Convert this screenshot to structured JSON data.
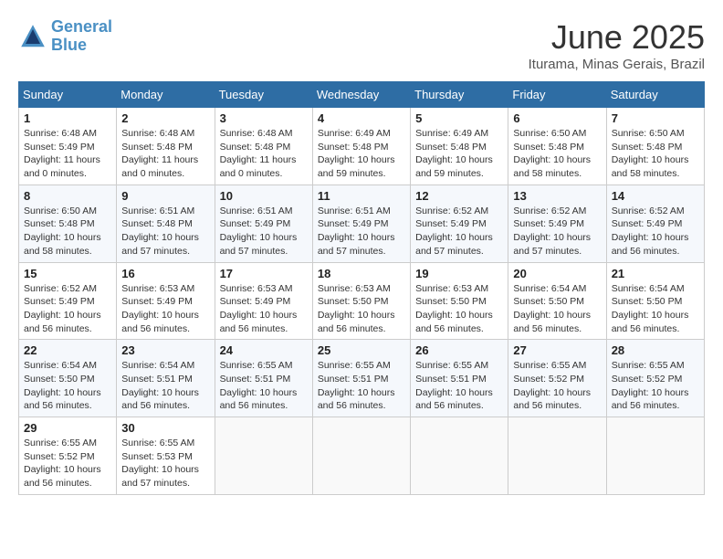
{
  "header": {
    "logo_line1": "General",
    "logo_line2": "Blue",
    "title": "June 2025",
    "subtitle": "Iturama, Minas Gerais, Brazil"
  },
  "columns": [
    "Sunday",
    "Monday",
    "Tuesday",
    "Wednesday",
    "Thursday",
    "Friday",
    "Saturday"
  ],
  "weeks": [
    [
      {
        "num": "1",
        "detail": "Sunrise: 6:48 AM\nSunset: 5:49 PM\nDaylight: 11 hours\nand 0 minutes."
      },
      {
        "num": "2",
        "detail": "Sunrise: 6:48 AM\nSunset: 5:48 PM\nDaylight: 11 hours\nand 0 minutes."
      },
      {
        "num": "3",
        "detail": "Sunrise: 6:48 AM\nSunset: 5:48 PM\nDaylight: 11 hours\nand 0 minutes."
      },
      {
        "num": "4",
        "detail": "Sunrise: 6:49 AM\nSunset: 5:48 PM\nDaylight: 10 hours\nand 59 minutes."
      },
      {
        "num": "5",
        "detail": "Sunrise: 6:49 AM\nSunset: 5:48 PM\nDaylight: 10 hours\nand 59 minutes."
      },
      {
        "num": "6",
        "detail": "Sunrise: 6:50 AM\nSunset: 5:48 PM\nDaylight: 10 hours\nand 58 minutes."
      },
      {
        "num": "7",
        "detail": "Sunrise: 6:50 AM\nSunset: 5:48 PM\nDaylight: 10 hours\nand 58 minutes."
      }
    ],
    [
      {
        "num": "8",
        "detail": "Sunrise: 6:50 AM\nSunset: 5:48 PM\nDaylight: 10 hours\nand 58 minutes."
      },
      {
        "num": "9",
        "detail": "Sunrise: 6:51 AM\nSunset: 5:48 PM\nDaylight: 10 hours\nand 57 minutes."
      },
      {
        "num": "10",
        "detail": "Sunrise: 6:51 AM\nSunset: 5:49 PM\nDaylight: 10 hours\nand 57 minutes."
      },
      {
        "num": "11",
        "detail": "Sunrise: 6:51 AM\nSunset: 5:49 PM\nDaylight: 10 hours\nand 57 minutes."
      },
      {
        "num": "12",
        "detail": "Sunrise: 6:52 AM\nSunset: 5:49 PM\nDaylight: 10 hours\nand 57 minutes."
      },
      {
        "num": "13",
        "detail": "Sunrise: 6:52 AM\nSunset: 5:49 PM\nDaylight: 10 hours\nand 57 minutes."
      },
      {
        "num": "14",
        "detail": "Sunrise: 6:52 AM\nSunset: 5:49 PM\nDaylight: 10 hours\nand 56 minutes."
      }
    ],
    [
      {
        "num": "15",
        "detail": "Sunrise: 6:52 AM\nSunset: 5:49 PM\nDaylight: 10 hours\nand 56 minutes."
      },
      {
        "num": "16",
        "detail": "Sunrise: 6:53 AM\nSunset: 5:49 PM\nDaylight: 10 hours\nand 56 minutes."
      },
      {
        "num": "17",
        "detail": "Sunrise: 6:53 AM\nSunset: 5:49 PM\nDaylight: 10 hours\nand 56 minutes."
      },
      {
        "num": "18",
        "detail": "Sunrise: 6:53 AM\nSunset: 5:50 PM\nDaylight: 10 hours\nand 56 minutes."
      },
      {
        "num": "19",
        "detail": "Sunrise: 6:53 AM\nSunset: 5:50 PM\nDaylight: 10 hours\nand 56 minutes."
      },
      {
        "num": "20",
        "detail": "Sunrise: 6:54 AM\nSunset: 5:50 PM\nDaylight: 10 hours\nand 56 minutes."
      },
      {
        "num": "21",
        "detail": "Sunrise: 6:54 AM\nSunset: 5:50 PM\nDaylight: 10 hours\nand 56 minutes."
      }
    ],
    [
      {
        "num": "22",
        "detail": "Sunrise: 6:54 AM\nSunset: 5:50 PM\nDaylight: 10 hours\nand 56 minutes."
      },
      {
        "num": "23",
        "detail": "Sunrise: 6:54 AM\nSunset: 5:51 PM\nDaylight: 10 hours\nand 56 minutes."
      },
      {
        "num": "24",
        "detail": "Sunrise: 6:55 AM\nSunset: 5:51 PM\nDaylight: 10 hours\nand 56 minutes."
      },
      {
        "num": "25",
        "detail": "Sunrise: 6:55 AM\nSunset: 5:51 PM\nDaylight: 10 hours\nand 56 minutes."
      },
      {
        "num": "26",
        "detail": "Sunrise: 6:55 AM\nSunset: 5:51 PM\nDaylight: 10 hours\nand 56 minutes."
      },
      {
        "num": "27",
        "detail": "Sunrise: 6:55 AM\nSunset: 5:52 PM\nDaylight: 10 hours\nand 56 minutes."
      },
      {
        "num": "28",
        "detail": "Sunrise: 6:55 AM\nSunset: 5:52 PM\nDaylight: 10 hours\nand 56 minutes."
      }
    ],
    [
      {
        "num": "29",
        "detail": "Sunrise: 6:55 AM\nSunset: 5:52 PM\nDaylight: 10 hours\nand 56 minutes."
      },
      {
        "num": "30",
        "detail": "Sunrise: 6:55 AM\nSunset: 5:53 PM\nDaylight: 10 hours\nand 57 minutes."
      },
      null,
      null,
      null,
      null,
      null
    ]
  ]
}
